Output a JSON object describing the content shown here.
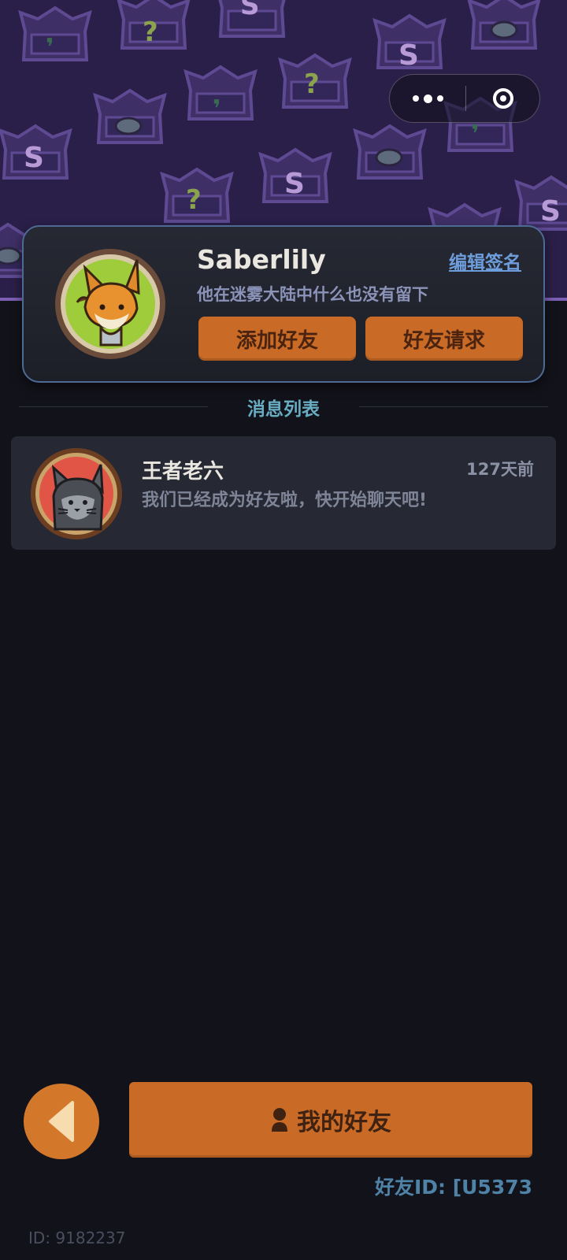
{
  "colors": {
    "background": "#12121a",
    "banner": "#2a1f48",
    "card": "#262833",
    "accent_orange": "#c96b26",
    "section_title": "#68adc2",
    "link": "#6e9ddb"
  },
  "capsule": {
    "more_icon": "more-dots-icon",
    "close_icon": "target-close-icon"
  },
  "profile": {
    "avatar_icon": "fox-avatar",
    "username": "Saberlily",
    "edit_signature": "编辑签名",
    "signature": "他在迷雾大陆中什么也没有留下",
    "add_friend": "添加好友",
    "friend_requests": "好友请求"
  },
  "messages": {
    "section_title": "消息列表",
    "items": [
      {
        "avatar_icon": "cat-avatar",
        "name": "王者老六",
        "time": "127天前",
        "text": "我们已经成为好友啦，快开始聊天吧!"
      }
    ]
  },
  "footer": {
    "back_icon": "back-arrow-icon",
    "my_friends_icon": "person-icon",
    "my_friends": "我的好友",
    "friend_id": "好友ID: [U5373",
    "user_id": "ID: 9182237"
  }
}
